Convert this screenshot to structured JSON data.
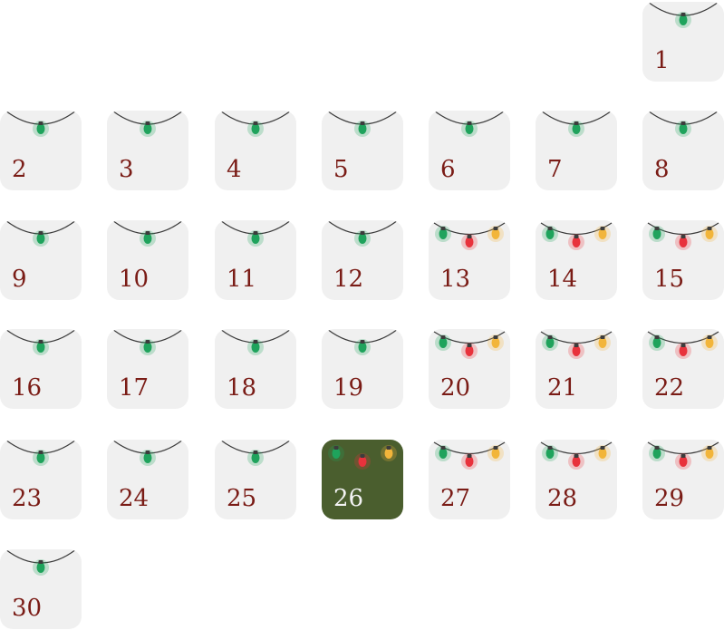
{
  "calendar": {
    "selected_day": 26,
    "colors": {
      "tile_bg": "#f0f0f0",
      "selected_bg": "#4a5e2e",
      "number": "#7a1c16",
      "selected_number": "#f3f3f3",
      "bulb_green": "#1fa35c",
      "bulb_red": "#e8323c",
      "bulb_yellow": "#f2b53a",
      "wire": "#3c3c3c"
    },
    "days": [
      {
        "label": "1",
        "lights": "single"
      },
      {
        "label": "2",
        "lights": "single"
      },
      {
        "label": "3",
        "lights": "single"
      },
      {
        "label": "4",
        "lights": "single"
      },
      {
        "label": "5",
        "lights": "single"
      },
      {
        "label": "6",
        "lights": "single"
      },
      {
        "label": "7",
        "lights": "single"
      },
      {
        "label": "8",
        "lights": "single"
      },
      {
        "label": "9",
        "lights": "single"
      },
      {
        "label": "10",
        "lights": "single"
      },
      {
        "label": "11",
        "lights": "single"
      },
      {
        "label": "12",
        "lights": "single"
      },
      {
        "label": "13",
        "lights": "triple"
      },
      {
        "label": "14",
        "lights": "triple"
      },
      {
        "label": "15",
        "lights": "triple"
      },
      {
        "label": "16",
        "lights": "single"
      },
      {
        "label": "17",
        "lights": "single"
      },
      {
        "label": "18",
        "lights": "single"
      },
      {
        "label": "19",
        "lights": "single"
      },
      {
        "label": "20",
        "lights": "triple"
      },
      {
        "label": "21",
        "lights": "triple"
      },
      {
        "label": "22",
        "lights": "triple"
      },
      {
        "label": "23",
        "lights": "single"
      },
      {
        "label": "24",
        "lights": "single"
      },
      {
        "label": "25",
        "lights": "single"
      },
      {
        "label": "26",
        "lights": "triple"
      },
      {
        "label": "27",
        "lights": "triple"
      },
      {
        "label": "28",
        "lights": "triple"
      },
      {
        "label": "29",
        "lights": "triple"
      },
      {
        "label": "30",
        "lights": "single"
      }
    ]
  }
}
